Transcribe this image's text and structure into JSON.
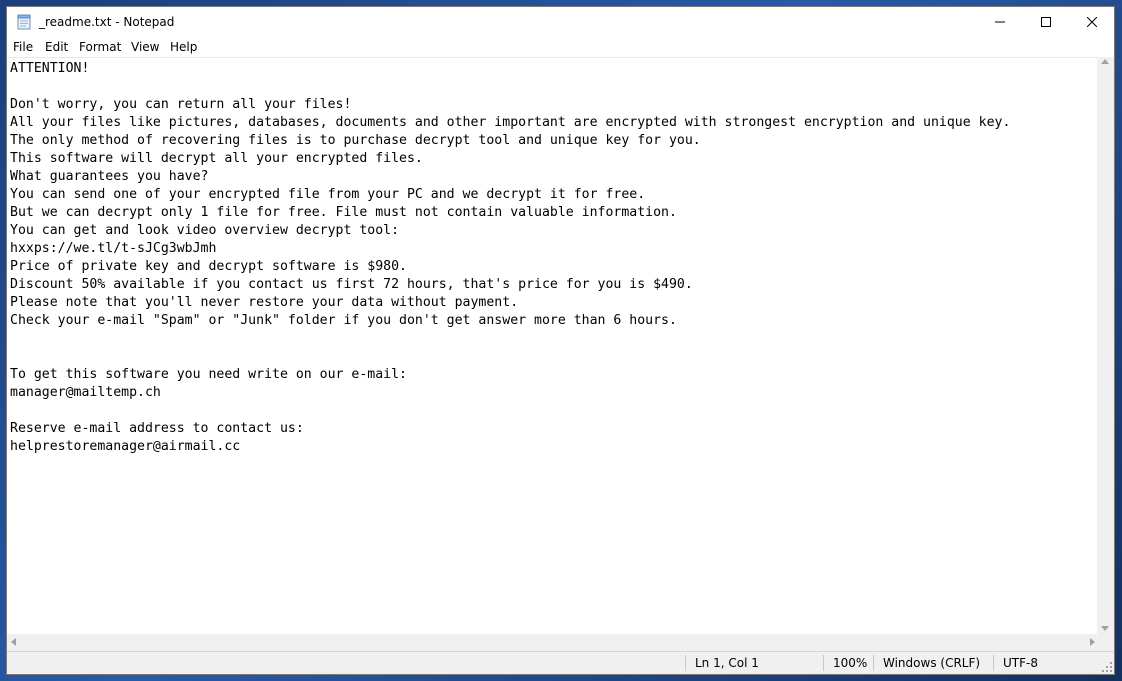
{
  "window": {
    "title": "_readme.txt - Notepad"
  },
  "icons": {
    "app": "notepad-icon",
    "minimize": "minimize-icon",
    "maximize": "maximize-icon",
    "close": "close-icon"
  },
  "menu": {
    "file": "File",
    "edit": "Edit",
    "format": "Format",
    "view": "View",
    "help": "Help"
  },
  "document": {
    "text": "ATTENTION!\n\nDon't worry, you can return all your files!\nAll your files like pictures, databases, documents and other important are encrypted with strongest encryption and unique key.\nThe only method of recovering files is to purchase decrypt tool and unique key for you.\nThis software will decrypt all your encrypted files.\nWhat guarantees you have?\nYou can send one of your encrypted file from your PC and we decrypt it for free.\nBut we can decrypt only 1 file for free. File must not contain valuable information.\nYou can get and look video overview decrypt tool:\nhxxps://we.tl/t-sJCg3wbJmh\nPrice of private key and decrypt software is $980.\nDiscount 50% available if you contact us first 72 hours, that's price for you is $490.\nPlease note that you'll never restore your data without payment.\nCheck your e-mail \"Spam\" or \"Junk\" folder if you don't get answer more than 6 hours.\n\n\nTo get this software you need write on our e-mail:\nmanager@mailtemp.ch\n\nReserve e-mail address to contact us:\nhelprestoremanager@airmail.cc"
  },
  "status": {
    "position": "Ln 1, Col 1",
    "zoom": "100%",
    "line_ending": "Windows (CRLF)",
    "encoding": "UTF-8"
  }
}
